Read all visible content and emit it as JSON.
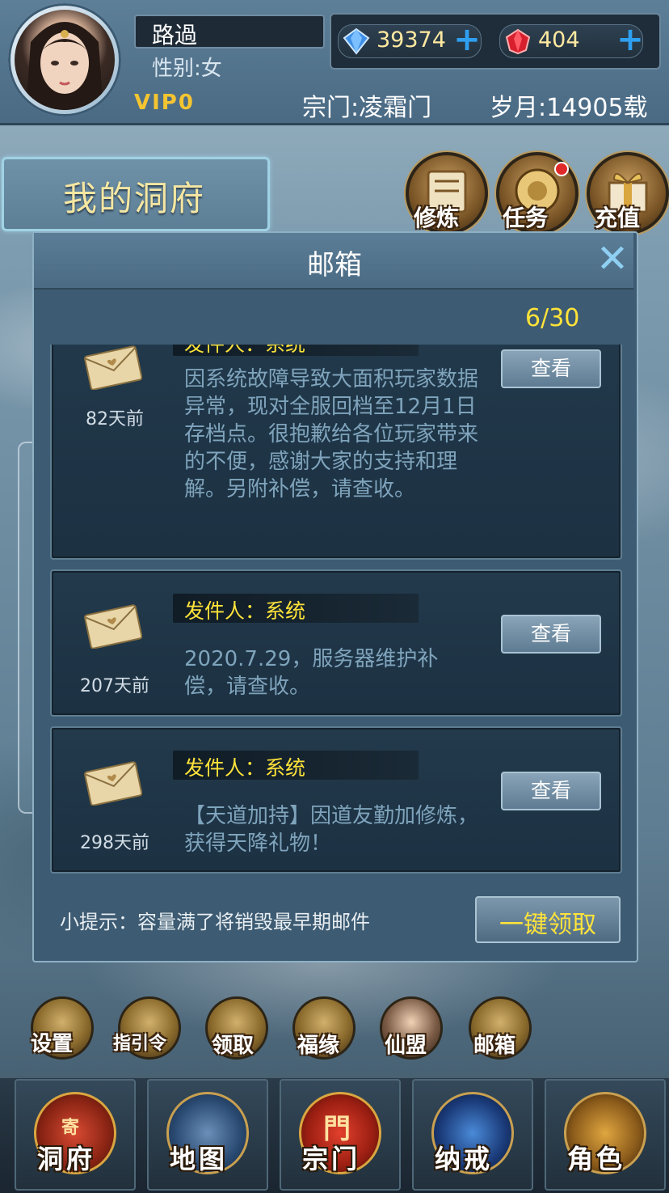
{
  "header": {
    "name": "路過",
    "gender": "性别:女",
    "vip": "VIP0",
    "diamonds": "39374",
    "rubies": "404",
    "sect": "宗门:凌霜门",
    "age": "岁月:14905载"
  },
  "cave_title": "我的洞府",
  "top_icons": [
    {
      "label": "修炼",
      "icon": "scroll-icon"
    },
    {
      "label": "任务",
      "icon": "quest-icon"
    },
    {
      "label": "充值",
      "icon": "gift-icon"
    }
  ],
  "mailbox": {
    "title": "邮箱",
    "count": "6/30",
    "view_label": "查看",
    "mails": [
      {
        "days": "82天前",
        "sender": "发件人：系统",
        "content": "因系统故障导致大面积玩家数据异常，现对全服回档至12月1日存档点。很抱歉给各位玩家带来的不便，感谢大家的支持和理解。另附补偿，请查收。"
      },
      {
        "days": "207天前",
        "sender": "发件人：系统",
        "content": "2020.7.29，服务器维护补偿，请查收。"
      },
      {
        "days": "298天前",
        "sender": "发件人：系统",
        "content": "【天道加持】因道友勤加修炼，获得天降礼物！"
      }
    ],
    "tip": "小提示：容量满了将销毁最早期邮件",
    "claim_all": "一键领取"
  },
  "bottom_icons": [
    {
      "label": "设置"
    },
    {
      "label": "指引令"
    },
    {
      "label": "领取"
    },
    {
      "label": "福缘"
    },
    {
      "label": "仙盟"
    },
    {
      "label": "邮箱"
    }
  ],
  "nav": [
    {
      "label": "洞府",
      "emblem": "寄"
    },
    {
      "label": "地图"
    },
    {
      "label": "宗门",
      "emblem": "門"
    },
    {
      "label": "纳戒"
    },
    {
      "label": "角色"
    }
  ],
  "colors": {
    "accent_yellow": "#ffe33a",
    "title_gold": "#f5e7a2",
    "plus_blue": "#2f9ff0"
  }
}
